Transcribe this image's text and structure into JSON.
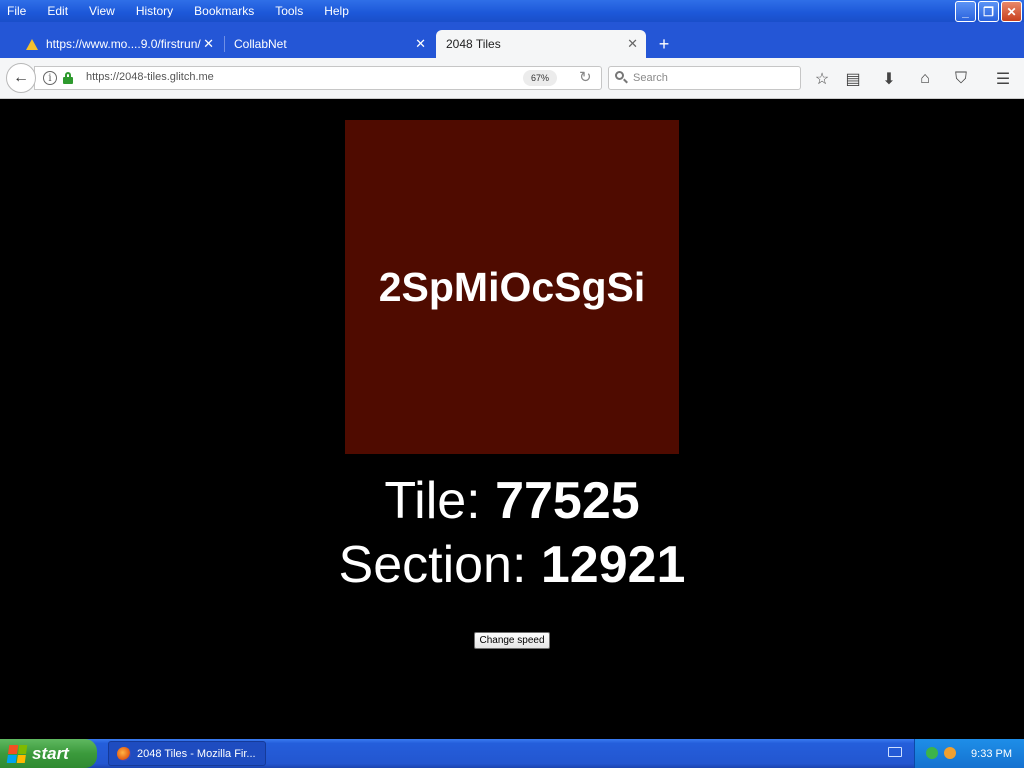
{
  "menu": [
    "File",
    "Edit",
    "View",
    "History",
    "Bookmarks",
    "Tools",
    "Help"
  ],
  "tabs": [
    {
      "label": "https://www.mo....9.0/firstrun/",
      "close": "✕"
    },
    {
      "label": "CollabNet",
      "close": "✕"
    },
    {
      "label": "2048 Tiles",
      "close": "✕"
    }
  ],
  "new_tab": "+",
  "navbar": {
    "url": "https://2048-tiles.glitch.me",
    "zoom": "67%",
    "search_placeholder": "Search"
  },
  "page": {
    "tile_text": "2SpMiOcSgSi",
    "tile_color": "#4f0b00",
    "tile_label": "Tile: ",
    "tile_value": "77525",
    "section_label": "Section: ",
    "section_value": "12921",
    "speed_button": "Change speed"
  },
  "taskbar": {
    "start": "start",
    "task": "2048 Tiles - Mozilla Fir...",
    "clock": "9:33 PM"
  }
}
